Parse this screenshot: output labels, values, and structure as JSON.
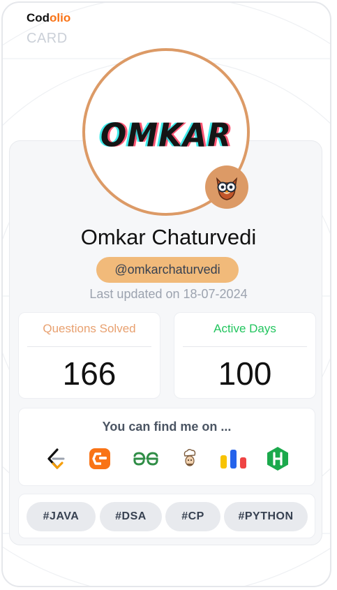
{
  "brand": {
    "name_part1": "Cod",
    "name_part2": "olio",
    "subtitle": "CARD"
  },
  "profile": {
    "avatar_text": "OMKAR",
    "badge_icon": "owl-icon",
    "name": "Omkar Chaturvedi",
    "handle": "@omkarchaturvedi",
    "last_updated": "Last updated on 18-07-2024"
  },
  "stats": [
    {
      "label": "Questions Solved",
      "value": "166",
      "color": "#e8a06f"
    },
    {
      "label": "Active Days",
      "value": "100",
      "color": "#22c55e"
    }
  ],
  "platforms": {
    "title": "You can find me on ...",
    "items": [
      {
        "name": "leetcode-icon"
      },
      {
        "name": "codestudio-icon"
      },
      {
        "name": "geeksforgeeks-icon"
      },
      {
        "name": "codechef-icon"
      },
      {
        "name": "interviewbit-icon"
      },
      {
        "name": "hackerrank-icon"
      }
    ]
  },
  "tags": [
    "#JAVA",
    "#DSA",
    "#CP",
    "#PYTHON"
  ],
  "colors": {
    "accent": "#f97316",
    "ring": "#dc9a66",
    "handle_bg": "#f1ba7a"
  }
}
